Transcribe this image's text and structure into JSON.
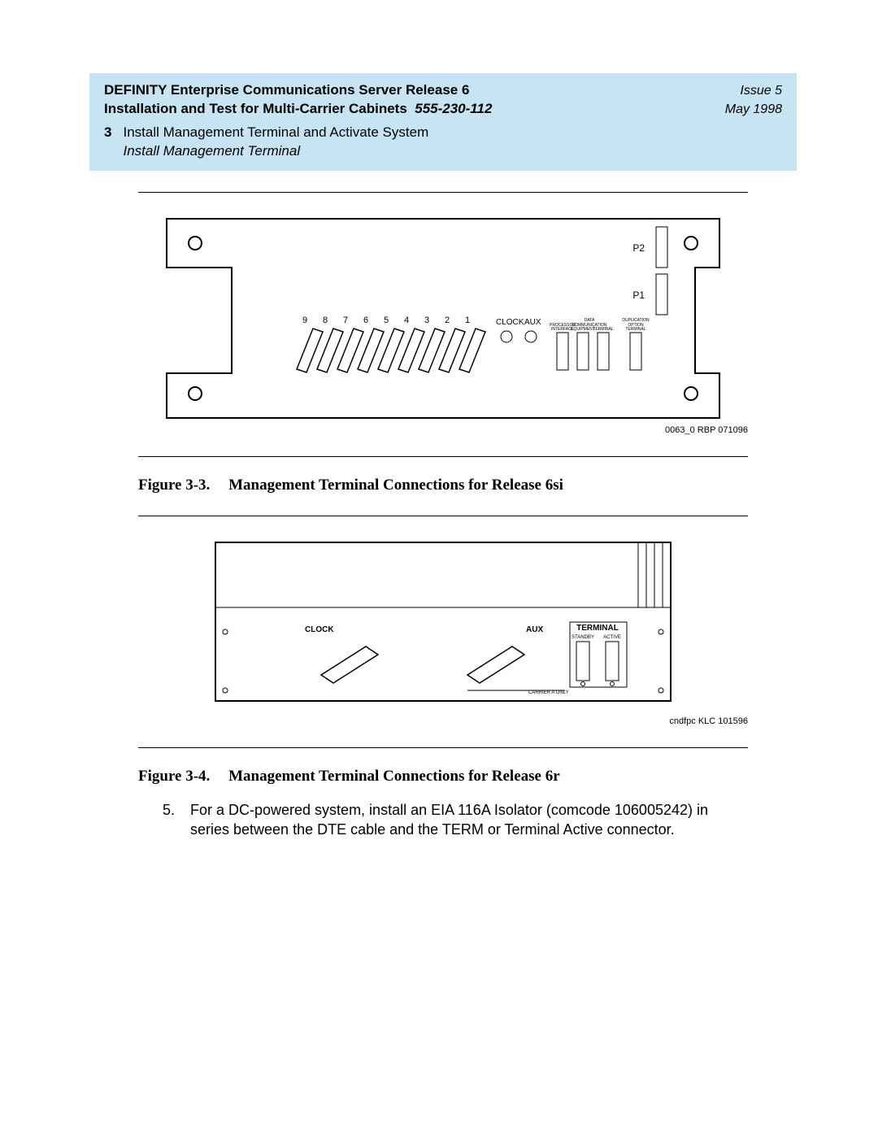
{
  "header": {
    "title": "DEFINITY Enterprise Communications Server Release 6",
    "subtitle_prefix": "Installation and Test for Multi-Carrier Cabinets",
    "doc_number": "555-230-112",
    "issue": "Issue 5",
    "date": "May 1998",
    "chapter_num": "3",
    "chapter_title": "Install Management Terminal and Activate System",
    "chapter_sub": "Install Management Terminal"
  },
  "fig3": {
    "caption_label": "Figure 3-3.",
    "caption_text": "Management Terminal Connections for Release 6si",
    "draw_code": "0063_0 RBP 071096",
    "port_labels": [
      "9",
      "8",
      "7",
      "6",
      "5",
      "4",
      "3",
      "2",
      "1"
    ],
    "clock_label": "CLOCK",
    "aux_label": "AUX",
    "right_ports": [
      "P2",
      "P1"
    ],
    "small_labels_top": [
      "DATA",
      "DUPLICATION"
    ],
    "small_labels_bot": [
      "PROCESSOR",
      "COMMUNICATION",
      "OPTION"
    ],
    "small_labels_bot2": [
      "INTERFACE",
      "EQUIPMENT",
      "TERMINAL",
      "TERMINAL"
    ]
  },
  "fig4": {
    "caption_label": "Figure 3-4.",
    "caption_text": "Management Terminal Connections for Release 6r",
    "draw_code": "cndfpc KLC 101596",
    "clock_label": "CLOCK",
    "aux_label": "AUX",
    "terminal_label": "TERMINAL",
    "sub_labels": [
      "STANDBY",
      "ACTIVE"
    ],
    "carrier_label": "CARRIER A ONLY"
  },
  "step5": {
    "num": "5.",
    "text": "For a DC-powered system, install an EIA 116A Isolator (comcode 106005242) in series between the DTE cable and the TERM or Terminal Active connector."
  }
}
